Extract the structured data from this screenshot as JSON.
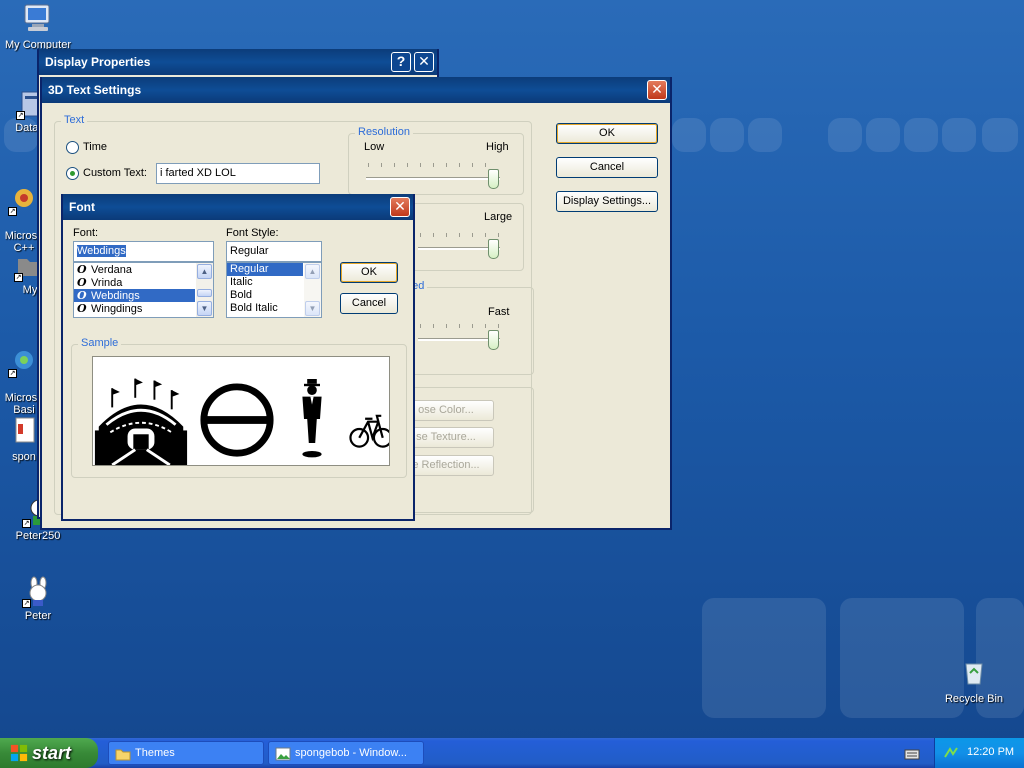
{
  "desktop": {
    "icons": [
      {
        "label": "My Computer"
      },
      {
        "label": "DataW"
      },
      {
        "label": "Microso\nC++"
      },
      {
        "label": "My"
      },
      {
        "label": "Microso\nBasi"
      },
      {
        "label": "spon"
      },
      {
        "label": "Peter250"
      },
      {
        "label": "Peter"
      },
      {
        "label": "Recycle Bin"
      }
    ]
  },
  "display_properties": {
    "title": "Display Properties",
    "help_glyph": "?",
    "close_glyph": "✕"
  },
  "text3d": {
    "title": "3D Text Settings",
    "close_glyph": "✕",
    "text_group": "Text",
    "time_label": "Time",
    "custom_label": "Custom Text:",
    "custom_value": "i farted XD LOL",
    "resolution_group": "Resolution",
    "res_low": "Low",
    "res_high": "High",
    "size_large": "Large",
    "speed_partial": "eed",
    "speed_fast": "Fast",
    "color_btn": "ose Color...",
    "texture_btn": "se Texture...",
    "reflection_btn": "e Reflection...",
    "ok": "OK",
    "cancel": "Cancel",
    "display_settings": "Display Settings..."
  },
  "font_dialog": {
    "title": "Font",
    "close_glyph": "✕",
    "font_label": "Font:",
    "font_value": "Webdings",
    "font_list": [
      "Verdana",
      "Vrinda",
      "Webdings",
      "Wingdings"
    ],
    "font_selected": "Webdings",
    "style_label": "Font Style:",
    "style_value": "Regular",
    "style_list": [
      "Regular",
      "Italic",
      "Bold",
      "Bold Italic"
    ],
    "style_selected": "Regular",
    "ok": "OK",
    "cancel": "Cancel",
    "sample_group": "Sample"
  },
  "taskbar": {
    "start": "start",
    "tasks": [
      "Themes",
      "spongebob - Window..."
    ],
    "time": "12:20 PM"
  },
  "colors": {
    "desktop_blue": "#1c5aa8",
    "title_blue": "#0c3c7a",
    "dialog_face": "#ece9d8",
    "selection": "#316ac5",
    "start_green": "#388a38"
  }
}
